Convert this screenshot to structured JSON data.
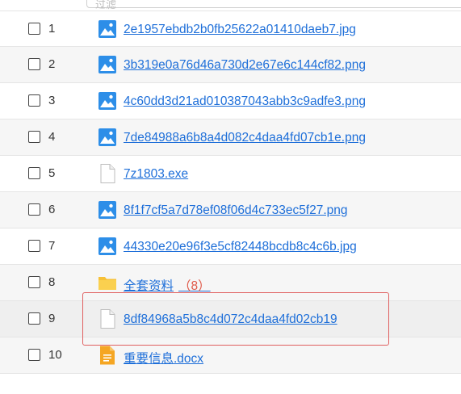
{
  "topbar": {
    "field_text": "过滤"
  },
  "files": [
    {
      "index": "1",
      "name": "2e1957ebdb2b0fb25622a01410daeb7.jpg",
      "icon": "image-file-icon",
      "count": ""
    },
    {
      "index": "2",
      "name": "3b319e0a76d46a730d2e67e6c144cf82.png",
      "icon": "image-file-icon",
      "count": ""
    },
    {
      "index": "3",
      "name": "4c60dd3d21ad010387043abb3c9adfe3.png",
      "icon": "image-file-icon",
      "count": ""
    },
    {
      "index": "4",
      "name": "7de84988a6b8a4d082c4daa4fd07cb1e.png",
      "icon": "image-file-icon",
      "count": ""
    },
    {
      "index": "5",
      "name": "7z1803.exe",
      "icon": "blank-file-icon",
      "count": ""
    },
    {
      "index": "6",
      "name": "8f1f7cf5a7d78ef08f06d4c733ec5f27.png",
      "icon": "image-file-icon",
      "count": ""
    },
    {
      "index": "7",
      "name": "44330e20e96f3e5cf82448bcdb8c4c6b.jpg",
      "icon": "image-file-icon",
      "count": ""
    },
    {
      "index": "8",
      "name": "全套资料",
      "icon": "folder-icon",
      "count": "（8）"
    },
    {
      "index": "9",
      "name": "8df84968a5b8c4d072c4daa4fd02cb19",
      "icon": "blank-file-icon",
      "count": ""
    },
    {
      "index": "10",
      "name": "重要信息.docx",
      "icon": "document-file-icon",
      "count": ""
    }
  ],
  "colors": {
    "link": "#1e6fd9",
    "image_icon": "#2d8ee8",
    "folder": "#f7c137",
    "doc": "#f5a623",
    "highlight": "#e06060"
  }
}
